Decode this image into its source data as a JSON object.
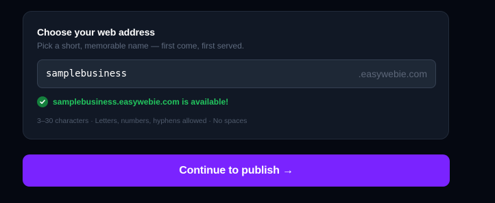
{
  "card": {
    "title": "Choose your web address",
    "subtitle": "Pick a short, memorable name — first come, first served.",
    "input": {
      "value": "samplebusiness",
      "suffix": ".easywebie.com"
    },
    "status": {
      "icon": "check-circle-icon",
      "text": "samplebusiness.easywebie.com is available!",
      "color": "#22c55e"
    },
    "hint": "3–30 characters · Letters, numbers, hyphens allowed · No spaces"
  },
  "publish_button": {
    "label": "Continue to publish →",
    "color": "#7a23ff"
  }
}
